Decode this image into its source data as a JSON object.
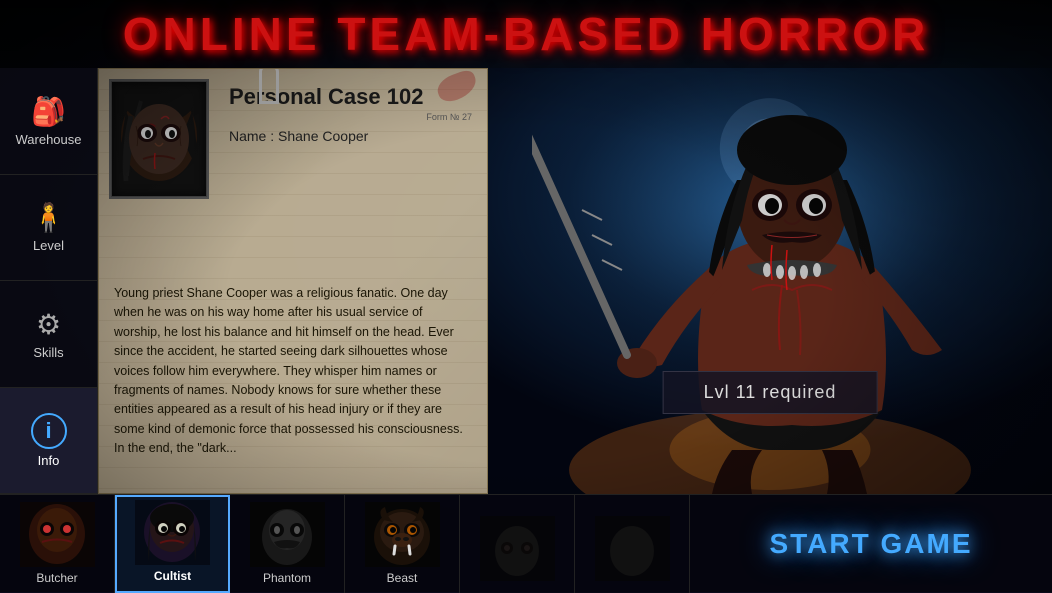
{
  "title": "ONLINE TEAM-BASED HORROR",
  "sidebar": {
    "items": [
      {
        "id": "warehouse",
        "label": "Warehouse",
        "icon": "🎒"
      },
      {
        "id": "level",
        "label": "Level",
        "icon": "🧍"
      },
      {
        "id": "skills",
        "label": "Skills",
        "icon": "⚙"
      },
      {
        "id": "info",
        "label": "Info",
        "icon": "i",
        "active": true
      }
    ]
  },
  "case": {
    "title": "Personal Case 102",
    "form_no": "Form № 27",
    "name_label": "Name : Shane Cooper",
    "description": "Young priest Shane Cooper was a religious fanatic. One day when he was on his way home after his usual service of worship, he lost his balance and hit himself on the head. Ever since the accident, he started seeing dark silhouettes whose voices follow him everywhere. They whisper him names or fragments of names. Nobody knows for sure whether these entities appeared as a result of his head injury or if they are some kind of demonic force that possessed his consciousness. In the end, the \"dark..."
  },
  "monster": {
    "level_required": "Lvl 11 required"
  },
  "characters": [
    {
      "id": "butcher",
      "label": "Butcher",
      "active": false
    },
    {
      "id": "cultist",
      "label": "Cultist",
      "active": true
    },
    {
      "id": "phantom",
      "label": "Phantom",
      "active": false
    },
    {
      "id": "beast",
      "label": "Beast",
      "active": false
    },
    {
      "id": "slot5",
      "label": "",
      "active": false
    },
    {
      "id": "slot6",
      "label": "",
      "active": false
    }
  ],
  "start_button": {
    "label": "START GAME"
  }
}
